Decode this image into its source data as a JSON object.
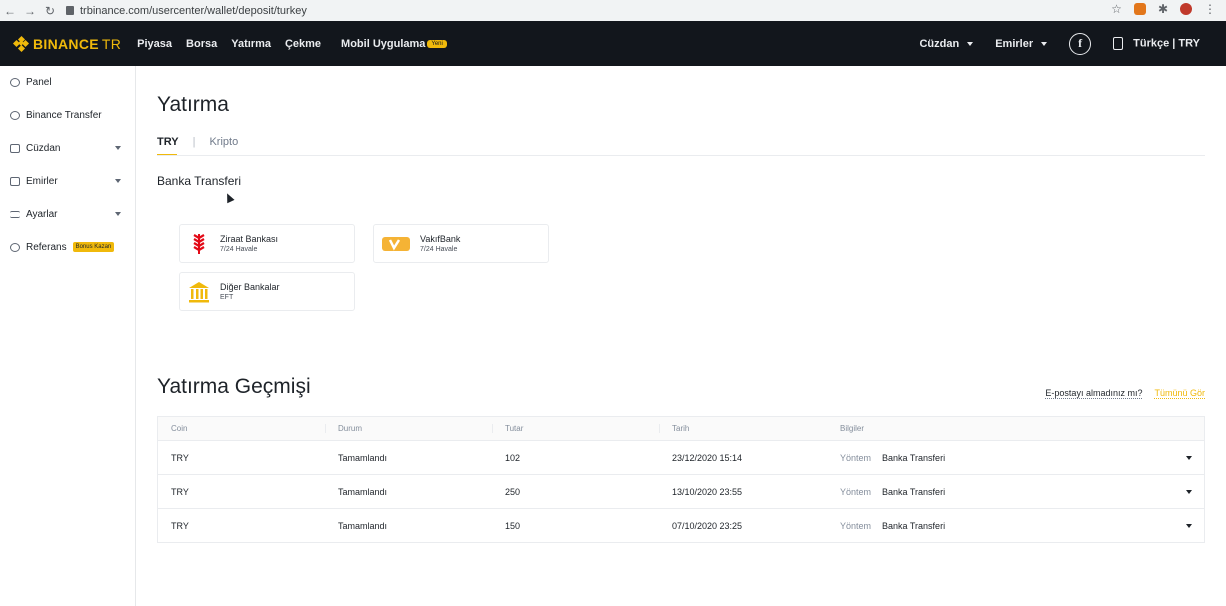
{
  "browser": {
    "url": "trbinance.com/usercenter/wallet/deposit/turkey",
    "nav_back": "←",
    "nav_forward": "→",
    "nav_reload": "↻",
    "star": "☆",
    "puzzle": "✱",
    "menu": "⋮"
  },
  "topnav": {
    "logo_text": "BINANCE",
    "logo_suffix": "TR",
    "links": [
      "Piyasa",
      "Borsa",
      "Yatırma",
      "Çekme",
      "Mobil Uygulama"
    ],
    "new_badge": "Yeni",
    "wallet": "Cüzdan",
    "orders": "Emirler",
    "fb": "f",
    "lang": "Türkçe | TRY"
  },
  "sidebar": {
    "items": [
      {
        "label": "Panel"
      },
      {
        "label": "Binance Transfer"
      },
      {
        "label": "Cüzdan"
      },
      {
        "label": "Emirler"
      },
      {
        "label": "Ayarlar"
      },
      {
        "label": "Referans"
      }
    ],
    "bonus_badge": "Bonus Kazan"
  },
  "main": {
    "title": "Yatırma",
    "tabs": [
      {
        "label": "TRY"
      },
      {
        "label": "Kripto"
      }
    ],
    "tab_separator": "|",
    "section_title": "Banka Transferi",
    "banks": [
      {
        "name": "Ziraat Bankası",
        "sub": "7/24 Havale",
        "color": "#e30a17"
      },
      {
        "name": "VakıfBank",
        "sub": "7/24 Havale",
        "color": "#f5b335"
      },
      {
        "name": "Diğer Bankalar",
        "sub": "EFT",
        "color": "#f0b90b"
      }
    ],
    "history_title": "Yatırma Geçmişi",
    "email_question": "E-postayı almadınız mı?",
    "see_all": "Tümünü Gör",
    "table": {
      "headers": [
        "Coin",
        "Durum",
        "Tutar",
        "Tarih",
        "Bilgiler"
      ],
      "method_label": "Yöntem",
      "rows": [
        {
          "coin": "TRY",
          "status": "Tamamlandı",
          "amount": "102",
          "date": "23/12/2020 15:14",
          "method": "Banka Transferi"
        },
        {
          "coin": "TRY",
          "status": "Tamamlandı",
          "amount": "250",
          "date": "13/10/2020 23:55",
          "method": "Banka Transferi"
        },
        {
          "coin": "TRY",
          "status": "Tamamlandı",
          "amount": "150",
          "date": "07/10/2020 23:25",
          "method": "Banka Transferi"
        }
      ]
    }
  },
  "colors": {
    "accent": "#f0b90b",
    "nav_bg": "#12161c"
  }
}
